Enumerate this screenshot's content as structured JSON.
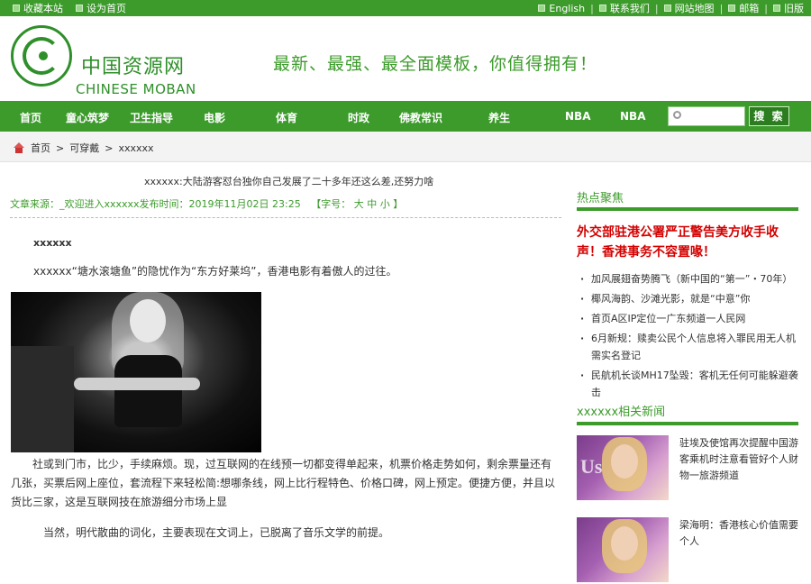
{
  "topbar": {
    "left": [
      "收藏本站",
      "设为首页"
    ],
    "right": [
      "English",
      "联系我们",
      "网站地图",
      "邮箱",
      "旧版"
    ]
  },
  "header": {
    "logo_cn": "中国资源网",
    "logo_en": "CHINESE MOBAN",
    "slogan": "最新、最强、最全面模板，你值得拥有！"
  },
  "nav": {
    "items": [
      "首页",
      "童心筑梦",
      "卫生指导",
      "电影",
      "体育",
      "时政",
      "佛教常识",
      "养生",
      "NBA",
      "NBA"
    ],
    "search_button": "搜 索",
    "search_placeholder": ""
  },
  "breadcrumb": [
    "首页",
    "可穿戴",
    "xxxxxx"
  ],
  "article": {
    "title": "xxxxxx:大陆游客怼台独你自己发展了二十多年还这么差,还努力啥",
    "meta_source": "文章来源：_欢迎进入xxxxxx发布时间：2019年11月02日 23:25",
    "meta_font": "【字号： 大 中 小 】",
    "lead_bold": "xxxxxx",
    "p1": "xxxxxx“塘水滚塘鱼”的隐忧作为“东方好莱坞”，香港电影有着傲人的过往。",
    "p2": "社或到门市，比少，手续麻烦。现，过互联网的在线预一切都变得单起来，机票价格走势如何，剩余票量还有几张，买票后网上座位，套流程下来轻松简:想哪条线，网上比行程特色、价格口碑，网上预定。便捷方便，并且以货比三家，这是互联网技在旅游细分市场上显",
    "p3": "当然，明代散曲的词化，主要表现在文词上，已脱离了音乐文学的前提。"
  },
  "sidebar": {
    "hot_title": "热点聚焦",
    "headline": "外交部驻港公署严正警告美方收手收声！香港事务不容置喙！",
    "hot_list": [
      "加风展翅奋势腾飞（新中国的“第一”・70年）",
      "椰风海韵、沙滩光影，就是“中意”你",
      "首页A区IP定位一广东频道一人民网",
      "6月新规：赎卖公民个人信息将入罪民用无人机需实名登记",
      "民航机长谈MH17坠毁：客机无任何可能躲避袭击"
    ],
    "related_title": "xxxxxx相关新闻",
    "related": [
      "驻埃及使馆再次提醒中国游客乘机时注意看管好个人财物一旅游频道",
      "梁海明：香港核心价值需要个人"
    ]
  },
  "colors": {
    "brand_green": "#3c9b2b",
    "headline_red": "#d40000"
  }
}
